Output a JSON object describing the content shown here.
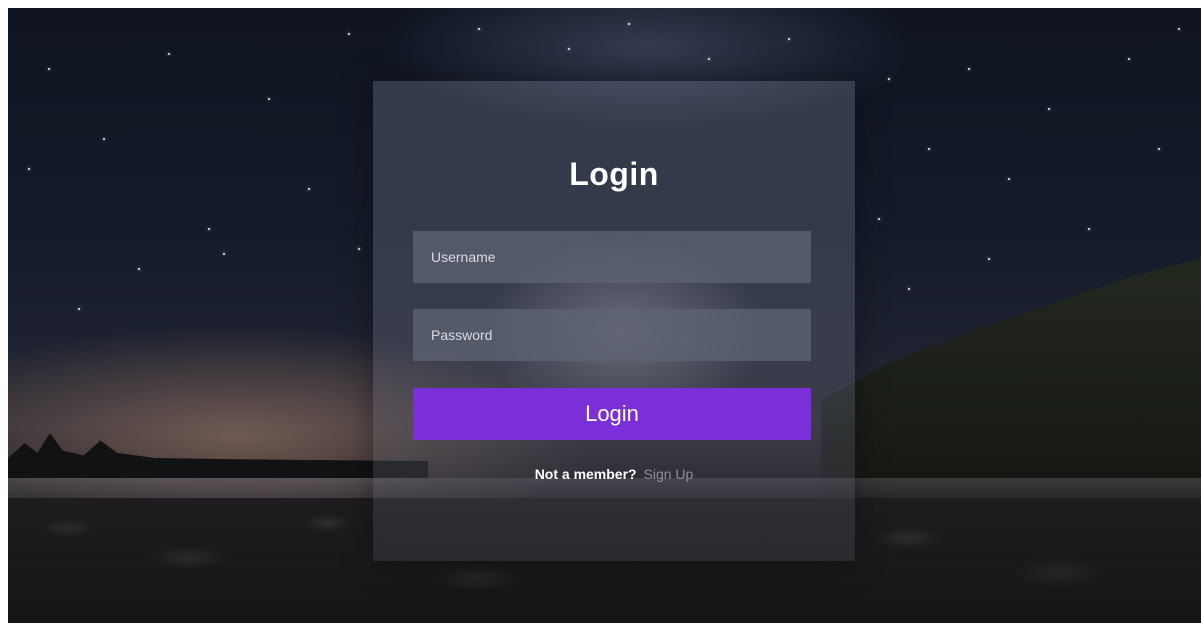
{
  "form": {
    "title": "Login",
    "username_placeholder": "Username",
    "password_placeholder": "Password",
    "login_button_label": "Login",
    "signup_prompt": "Not a member?",
    "signup_link_label": "Sign Up"
  },
  "colors": {
    "accent": "#7b2fd8",
    "field_bg": "#5f6473",
    "text": "#ffffff",
    "link_muted": "#8d8f99"
  }
}
